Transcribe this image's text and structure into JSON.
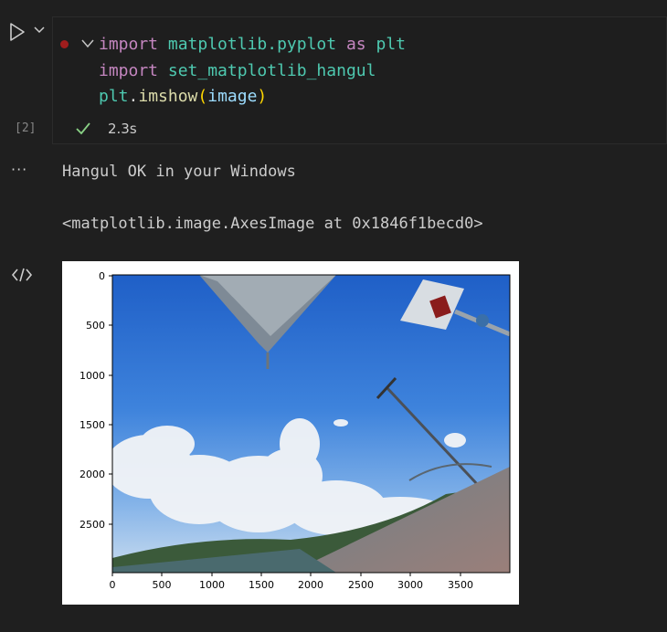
{
  "cell": {
    "execution_count": "[2]",
    "exec_time": "2.3s",
    "code_lines": [
      "import matplotlib.pyplot as plt",
      "import set_matplotlib_hangul",
      "plt.imshow(image)"
    ],
    "tokens": {
      "kw_import": "import",
      "kw_as": "as",
      "mod_pyplot": "matplotlib.pyplot",
      "alias_plt": "plt",
      "mod_hangul": "set_matplotlib_hangul",
      "plt_call": "plt",
      "dot": ".",
      "fn_imshow": "imshow",
      "paren_open": "(",
      "arg_image": "image",
      "paren_close": ")"
    }
  },
  "output": {
    "more_label": "···",
    "lines": [
      "Hangul OK in your Windows",
      "<matplotlib.image.AxesImage at 0x1846f1becd0>"
    ]
  },
  "colors": {
    "keyword": "#c586c0",
    "module": "#4ec9b0",
    "variable": "#9cdcfe",
    "function": "#dcdcaa",
    "bracket": "#ffd700",
    "success_check": "#89d185",
    "breakpoint": "#a01d1d"
  },
  "icons": {
    "run": "run-cell-icon",
    "run_menu": "chevron-down-icon",
    "fold": "chevron-down-icon",
    "status": "check-icon",
    "output_type": "code-icon"
  },
  "figure": {
    "x_ticks": [
      "0",
      "500",
      "1000",
      "1500",
      "2000",
      "2500",
      "3000",
      "3500"
    ],
    "y_ticks": [
      "0",
      "500",
      "1000",
      "1500",
      "2000",
      "2500"
    ]
  }
}
